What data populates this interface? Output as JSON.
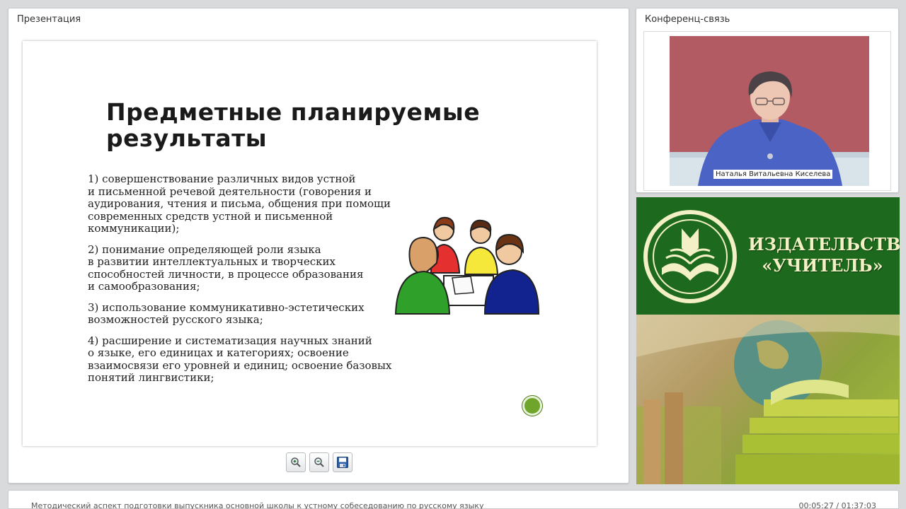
{
  "presentation": {
    "title": "Презентация",
    "slide": {
      "heading": "Предметные планируемые\nрезультаты",
      "items": [
        "1) совершенствование различных видов устной\nи письменной речевой деятельности (говорения и\nаудирования, чтения и письма, общения при помощи\nсовременных средств устной и письменной\nкоммуникации);",
        "2) понимание определяющей роли языка\nв развитии интеллектуальных и творческих\nспособностей личности, в процессе образования\nи самообразования;",
        "3) использование коммуникативно-эстетических\nвозможностей русского языка;",
        "4) расширение и систематизация научных знаний\nо языке, его единицах и категориях; освоение\nвзаимосвязи его уровней и единиц; освоение базовых\nпонятий лингвистики;"
      ]
    },
    "toolbar": {
      "zoom_in_icon": "zoom-in-icon",
      "zoom_out_icon": "zoom-out-icon",
      "save_icon": "save-icon"
    }
  },
  "conference": {
    "title": "Конференц-связь",
    "speaker_name": "Наталья Витальевна Киселева"
  },
  "publisher": {
    "line1": "ИЗДАТЕЛЬСТВО",
    "line2": "«УЧИТЕЛЬ»"
  },
  "footer": {
    "lecture_title": "Методический аспект подготовки выпускника основной школы к устному собеседованию по русскому языку",
    "time": "00:05:27 / 01:37:03"
  },
  "colors": {
    "accent_green": "#1d6a1e",
    "nav_dot": "#6fa52a",
    "video_bg": "#b25b63"
  }
}
